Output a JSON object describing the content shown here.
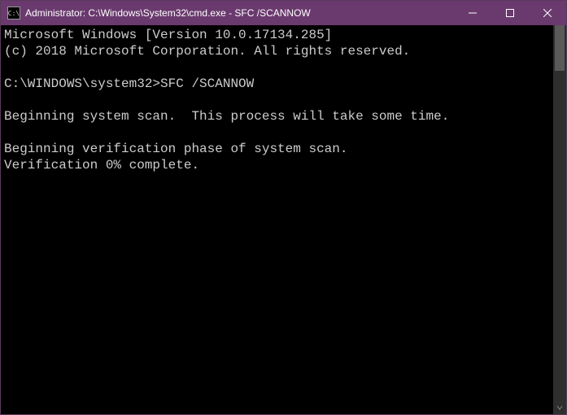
{
  "titlebar": {
    "icon_label": "C:\\",
    "title": "Administrator: C:\\Windows\\System32\\cmd.exe - SFC  /SCANNOW"
  },
  "terminal": {
    "lines": [
      "Microsoft Windows [Version 10.0.17134.285]",
      "(c) 2018 Microsoft Corporation. All rights reserved.",
      "",
      "C:\\WINDOWS\\system32>SFC /SCANNOW",
      "",
      "Beginning system scan.  This process will take some time.",
      "",
      "Beginning verification phase of system scan.",
      "Verification 0% complete."
    ]
  }
}
